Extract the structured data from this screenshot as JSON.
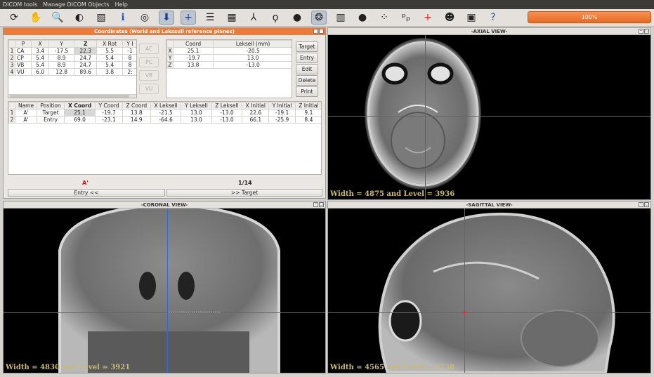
{
  "menubar": {
    "items": [
      "DICOM tools",
      "Manage DICOM Objects",
      "Help"
    ]
  },
  "toolbar": {
    "buttons": [
      {
        "name": "refresh-icon",
        "glyph": "⟳"
      },
      {
        "name": "pan-hand-icon",
        "glyph": "✋"
      },
      {
        "name": "zoom-icon",
        "glyph": "🔍"
      },
      {
        "name": "contrast-icon",
        "glyph": "◐"
      },
      {
        "name": "invert-icon",
        "glyph": "▧"
      },
      {
        "name": "info-icon",
        "glyph": "ℹ"
      },
      {
        "name": "overlay-icon",
        "glyph": "◎"
      },
      {
        "name": "probe-icon",
        "glyph": "⬇"
      },
      {
        "name": "crosshair-icon",
        "glyph": "+"
      },
      {
        "name": "stack-icon",
        "glyph": "☰"
      },
      {
        "name": "layout-grid-icon",
        "glyph": "▦"
      },
      {
        "name": "axes-icon",
        "glyph": "⅄"
      },
      {
        "name": "lasso-icon",
        "glyph": "ϙ"
      },
      {
        "name": "sphere-icon",
        "glyph": "●"
      },
      {
        "name": "brain-3d-icon",
        "glyph": "❂"
      },
      {
        "name": "colormap-icon",
        "glyph": "▥"
      },
      {
        "name": "sphere-grey-icon",
        "glyph": "●"
      },
      {
        "name": "scatter-points-icon",
        "glyph": "⁘"
      },
      {
        "name": "points-pp-icon",
        "glyph": "ᵖₚ"
      },
      {
        "name": "red-cross-icon",
        "glyph": "+"
      },
      {
        "name": "head-3d-icon",
        "glyph": "☻"
      },
      {
        "name": "dicom-icon",
        "glyph": "▣"
      },
      {
        "name": "help-icon",
        "glyph": "?"
      }
    ],
    "progress_label": "100%"
  },
  "coords_panel": {
    "title": "Coordinates (World and Lekssell reference planes)",
    "points_table": {
      "headers": [
        "P",
        "X",
        "Y",
        "Z",
        "X Rot",
        "Y I"
      ],
      "rows": [
        {
          "idx": "1",
          "cells": [
            "CA",
            "3.4",
            "-17.5",
            "22.3",
            "5.5",
            "-1"
          ]
        },
        {
          "idx": "2",
          "cells": [
            "CP",
            "5.4",
            "8.9",
            "24.7",
            "5.4",
            "8"
          ]
        },
        {
          "idx": "3",
          "cells": [
            "VB",
            "5.4",
            "8.9",
            "24.7",
            "5.4",
            "8"
          ]
        },
        {
          "idx": "4",
          "cells": [
            "VU",
            "6.0",
            "12.8",
            "89.6",
            "3.8",
            "2:"
          ]
        }
      ]
    },
    "point_buttons": [
      "AC",
      "PC",
      "VB",
      "VU"
    ],
    "coord_table": {
      "headers": [
        "Coord",
        "Leksell (mm)"
      ],
      "rows": [
        {
          "idx": "X",
          "cells": [
            "25.1",
            "-20.5"
          ]
        },
        {
          "idx": "Y",
          "cells": [
            "-19.7",
            "13.0"
          ]
        },
        {
          "idx": "Z",
          "cells": [
            "13.8",
            "-13.0"
          ]
        }
      ]
    },
    "action_buttons": [
      "Target",
      "Entry",
      "Edit",
      "Delete",
      "Print"
    ],
    "trajectory_table": {
      "headers": [
        "Name",
        "Position",
        "X Coord",
        "Y Coord",
        "Z Coord",
        "X Leksell",
        "Y Leksell",
        "Z Leksell",
        "X Initial",
        "Y Initial",
        "Z Initial"
      ],
      "rows": [
        {
          "idx": "1",
          "cells": [
            "A'",
            "Target",
            "25.1",
            "-19.7",
            "13.8",
            "-21.5",
            "13.0",
            "-13.0",
            "22.6",
            "-19.1",
            "9.1"
          ]
        },
        {
          "idx": "2",
          "cells": [
            "A'",
            "Entry",
            "69.0",
            "-23.1",
            "14.9",
            "-64.6",
            "13.0",
            "-13.0",
            "66.1",
            "-25.9",
            "8.4"
          ]
        }
      ]
    },
    "current_name": "A'",
    "page_counter": "1/14",
    "entry_nav": "Entry   <<",
    "target_nav": ">>   Target"
  },
  "views": {
    "axial": {
      "title": "-AXIAL VIEW-",
      "width_level": "Width = 4875 and Level =  3936"
    },
    "coronal": {
      "title": "-CORONAL VIEW-",
      "width_level": "Width = 4830 and Level =  3921"
    },
    "sagittal": {
      "title": "-SAGITTAL VIEW-",
      "width_level": "Width = 4565 and Level =  3738"
    }
  },
  "colors": {
    "accent": "#ef7a38",
    "crosshair": "#2b6fd6",
    "menubar": "#3c3b37"
  }
}
